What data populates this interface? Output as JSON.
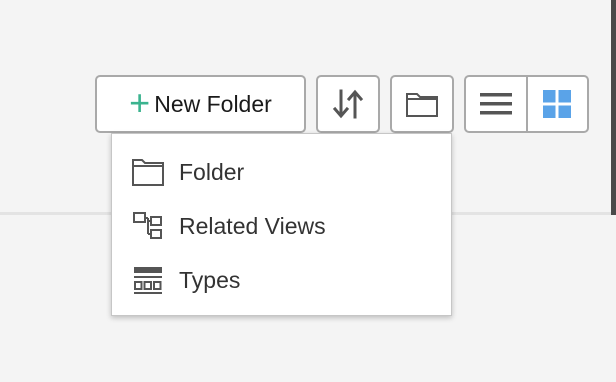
{
  "toolbar": {
    "new_folder_label": "New Folder",
    "plus_glyph": "+",
    "sort_icon": "sort-arrows-icon",
    "folder_icon": "folder-icon",
    "list_view_icon": "list-view-icon",
    "grid_view_icon": "grid-view-icon",
    "active_view": "grid"
  },
  "menu": {
    "items": [
      {
        "label": "Folder",
        "icon": "folder-icon"
      },
      {
        "label": "Related Views",
        "icon": "related-views-icon"
      },
      {
        "label": "Types",
        "icon": "types-icon"
      }
    ]
  },
  "colors": {
    "accent_green": "#3bb38f",
    "grid_active_blue": "#5aa3e8",
    "icon_gray": "#555555",
    "border_gray": "#a9a9a9"
  }
}
